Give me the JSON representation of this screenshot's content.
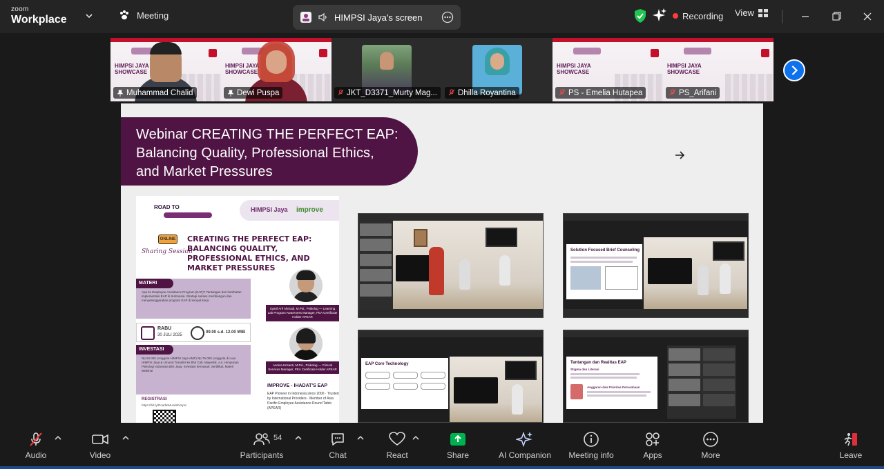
{
  "app": {
    "brand_small": "zoom",
    "brand_large": "Workplace"
  },
  "topbar": {
    "meeting_label": "Meeting",
    "screen_share_label": "HIMPSI Jaya's screen",
    "recording_label": "Recording",
    "view_label": "View"
  },
  "participants": [
    {
      "name": "Muhammad Chalid",
      "muted": false,
      "active": true
    },
    {
      "name": "Dewi Puspa",
      "muted": false,
      "active": false
    },
    {
      "name": "JKT_D3371_Murty Mag...",
      "muted": true,
      "active": false
    },
    {
      "name": "Dhilla Royantina",
      "muted": true,
      "active": false
    },
    {
      "name": "PS - Emelia Hutapea",
      "muted": true,
      "active": false
    },
    {
      "name": "PS_Arifani",
      "muted": true,
      "active": false
    }
  ],
  "tile_banner": {
    "line1": "HIMPSI JAYA",
    "line2": "SHOWCASE"
  },
  "slide": {
    "title_lines": [
      "Webinar CREATING THE PERFECT EAP:",
      "Balancing Quality, Professional Ethics,",
      "and Market Pressures"
    ]
  },
  "poster": {
    "road_to": "ROAD TO",
    "logo_himpsi": "HIMPSI Jaya",
    "logo_improve": "improve",
    "online_badge": "ONLINE",
    "sharing_session": "Sharing Session",
    "headline": "CREATING THE PERFECT EAP: BALANCING QUALITY, PROFESSIONAL ETHICS, AND MARKET PRESSURES",
    "materi_label": "MATERI",
    "materi_text": "Apa itu Employee Assistance Program (EAP)? Tantangan dan hambatan implementasi EAP di Indonesia. Strategi sukses membangun dan menyelenggarakan program EAP di tempat kerja",
    "date_day": "RABU",
    "date_text": "30 JULI 2025",
    "time_text": "09.00 s.d. 12.00 WIB",
    "investasi_label": "INVESTASI",
    "investasi_text": "Rp 50.000 (Anggota HIMPSI Jaya AMF) Rp 75.000 (Anggota di Luar HIMPSI Jaya & Umum) Transfer ke BNI Cab. Mayestik. a.n. Himpunan Psikologi Indonesia BNI Jaya. Investasi termasuk: Sertifikat, Materi Webinar",
    "speaker1_caption": "Syarif Arif Ahmadi, M.Psi., Psikolog — Learning Lab Program Awareness Manager, PEA Certificate Holder APEAR",
    "speaker2_caption": "Annisa Krisanti, M.Psi., Psikolog — Clinical Services Manager, PEA Certificate Holder APEAR",
    "improve_title": "IMPROVE - IHADAT'S EAP",
    "improve_list": "EAP Pioneer in Indonesia since 2000 · Trusted by International Providers · Member of Asia Pacific Employee Assistance Round Table (APEAR)",
    "registrasi": "REGISTRASI",
    "registrasi_link": "https://bit.ly/RoadtoMusdahimpsi"
  },
  "screens": {
    "s2_title": "Solution Focused Brief Counseling",
    "s3_title": "EAP Core Technology",
    "s4_title": "Tantangan dan Realitas EAP",
    "s4_sub1": "Stigma dan Literasi",
    "s4_sub2": "Anggaran dan Prioritas Perusahaan"
  },
  "toolbar": {
    "audio": "Audio",
    "video": "Video",
    "participants": "Participants",
    "participants_count": "54",
    "chat": "Chat",
    "react": "React",
    "share": "Share",
    "ai_companion": "AI Companion",
    "meeting_info": "Meeting info",
    "apps": "Apps",
    "more": "More",
    "leave": "Leave"
  },
  "colors": {
    "accent_blue": "#0e72ed",
    "share_green": "#00b14f",
    "record_red": "#ff3b3b",
    "slide_purple": "#4f1444",
    "active_outline": "#2ecc71"
  }
}
